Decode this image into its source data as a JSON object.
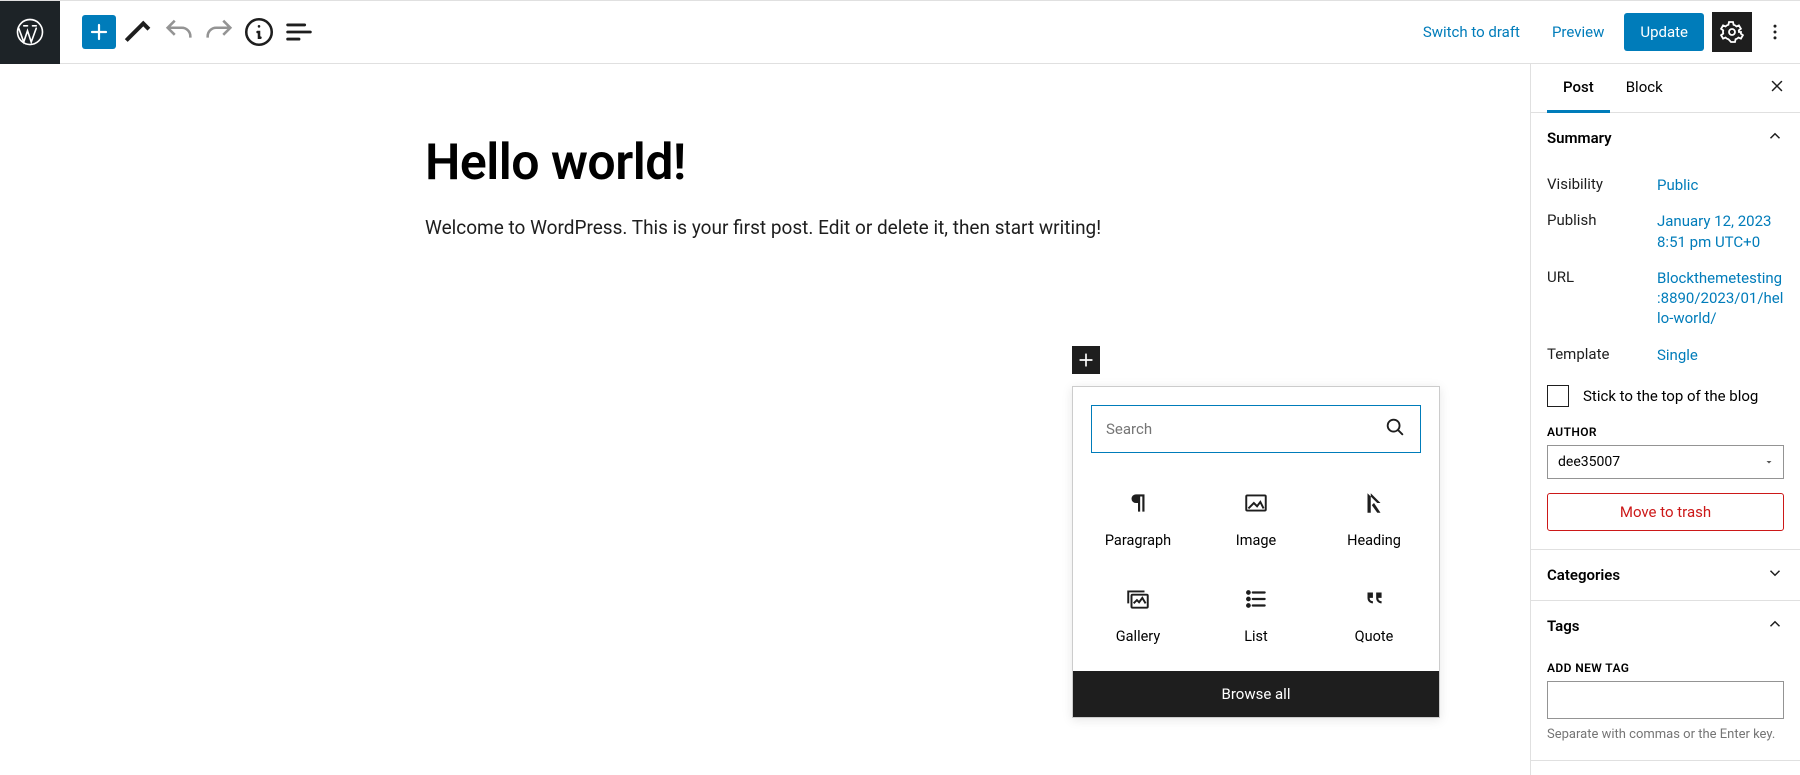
{
  "topbar": {
    "switch_to_draft": "Switch to draft",
    "preview": "Preview",
    "update": "Update"
  },
  "post": {
    "title": "Hello world!",
    "body": "Welcome to WordPress. This is your first post. Edit or delete it, then start writing!"
  },
  "inserter": {
    "search_placeholder": "Search",
    "blocks": {
      "paragraph": "Paragraph",
      "image": "Image",
      "heading": "Heading",
      "gallery": "Gallery",
      "list": "List",
      "quote": "Quote"
    },
    "browse_all": "Browse all"
  },
  "sidebar": {
    "tabs": {
      "post": "Post",
      "block": "Block"
    },
    "summary": {
      "title": "Summary",
      "visibility_label": "Visibility",
      "visibility": "Public",
      "publish_label": "Publish",
      "publish": "January 12, 2023 8:51 pm UTC+0",
      "url_label": "URL",
      "url": "Blockthemetesting:8890/2023/01/hello-world/",
      "template_label": "Template",
      "template": "Single",
      "sticky": "Stick to the top of the blog",
      "author_label": "AUTHOR",
      "author": "dee35007",
      "move_to_trash": "Move to trash"
    },
    "categories": {
      "title": "Categories"
    },
    "tags": {
      "title": "Tags",
      "add_new": "ADD NEW TAG",
      "hint": "Separate with commas or the Enter key."
    }
  }
}
